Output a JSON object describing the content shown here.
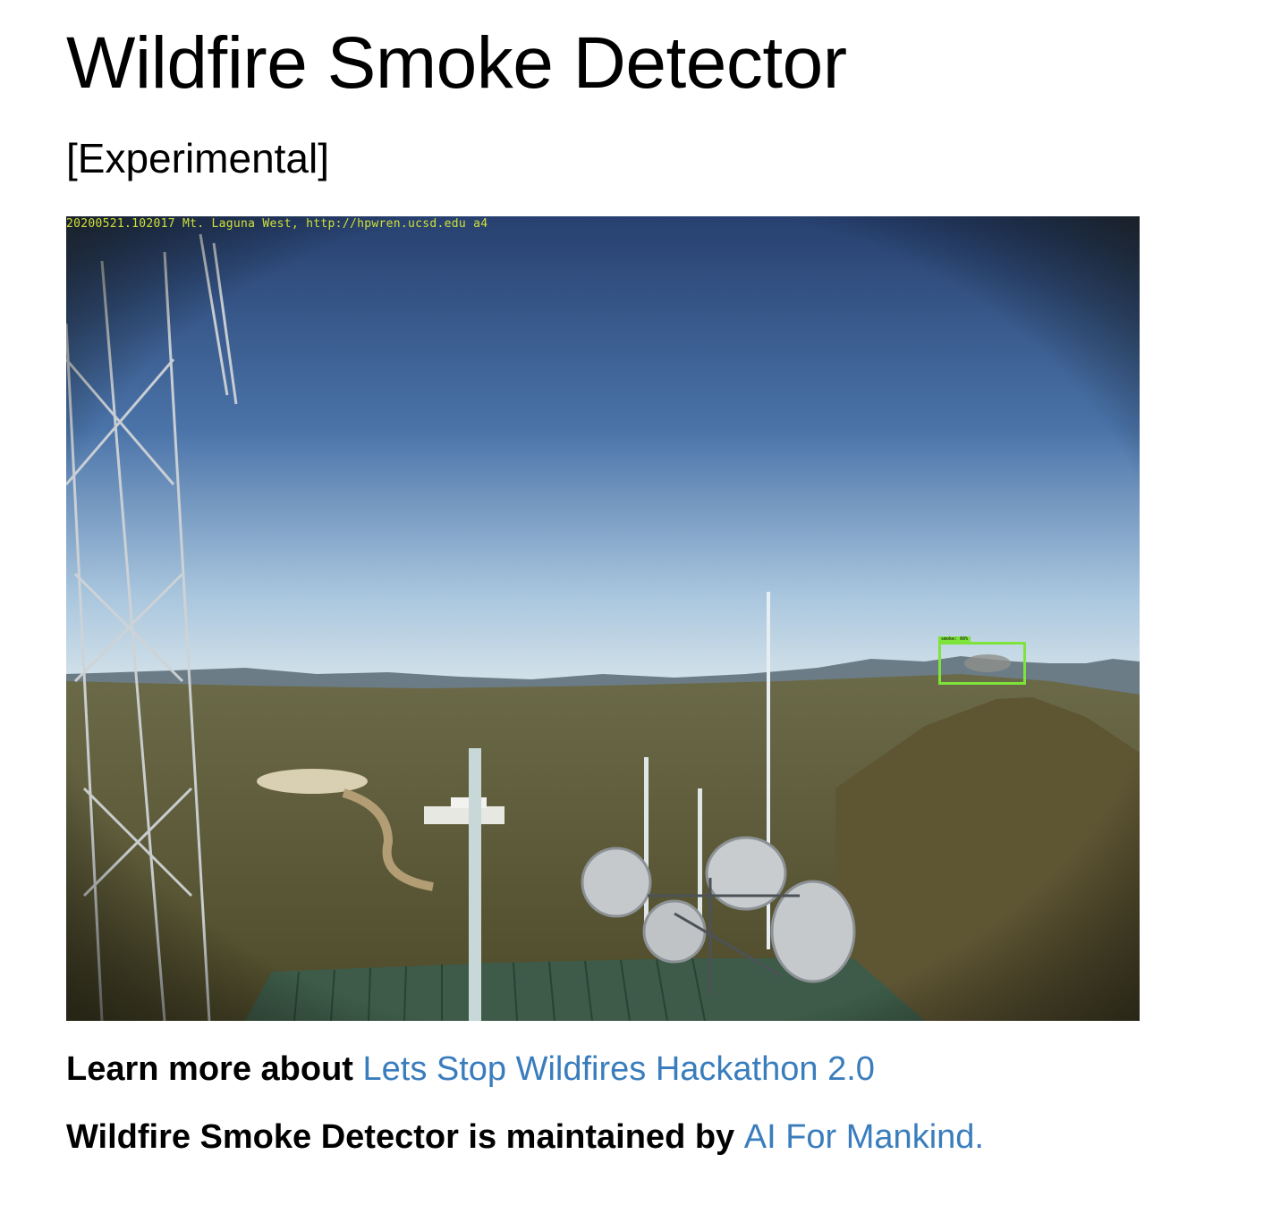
{
  "header": {
    "title": "Wildfire Smoke Detector",
    "subtitle": "[Experimental]"
  },
  "camera": {
    "overlay_text": "20200521.102017 Mt. Laguna West, http://hpwren.ucsd.edu a4",
    "detection": {
      "label": "smoke: 66%",
      "box_color": "#7ee33a"
    }
  },
  "footer": {
    "learn_prefix": "Learn more about ",
    "hackathon_link": "Lets Stop Wildfires Hackathon 2.0",
    "maintained_prefix": "Wildfire Smoke Detector is maintained by ",
    "org_link": "AI For Mankind."
  },
  "colors": {
    "link": "#3a7dbd",
    "sky_top": "#2c4a7e",
    "sky_horizon": "#c4d8e6",
    "terrain": "#5b5a34",
    "roof": "#3c5a48"
  }
}
